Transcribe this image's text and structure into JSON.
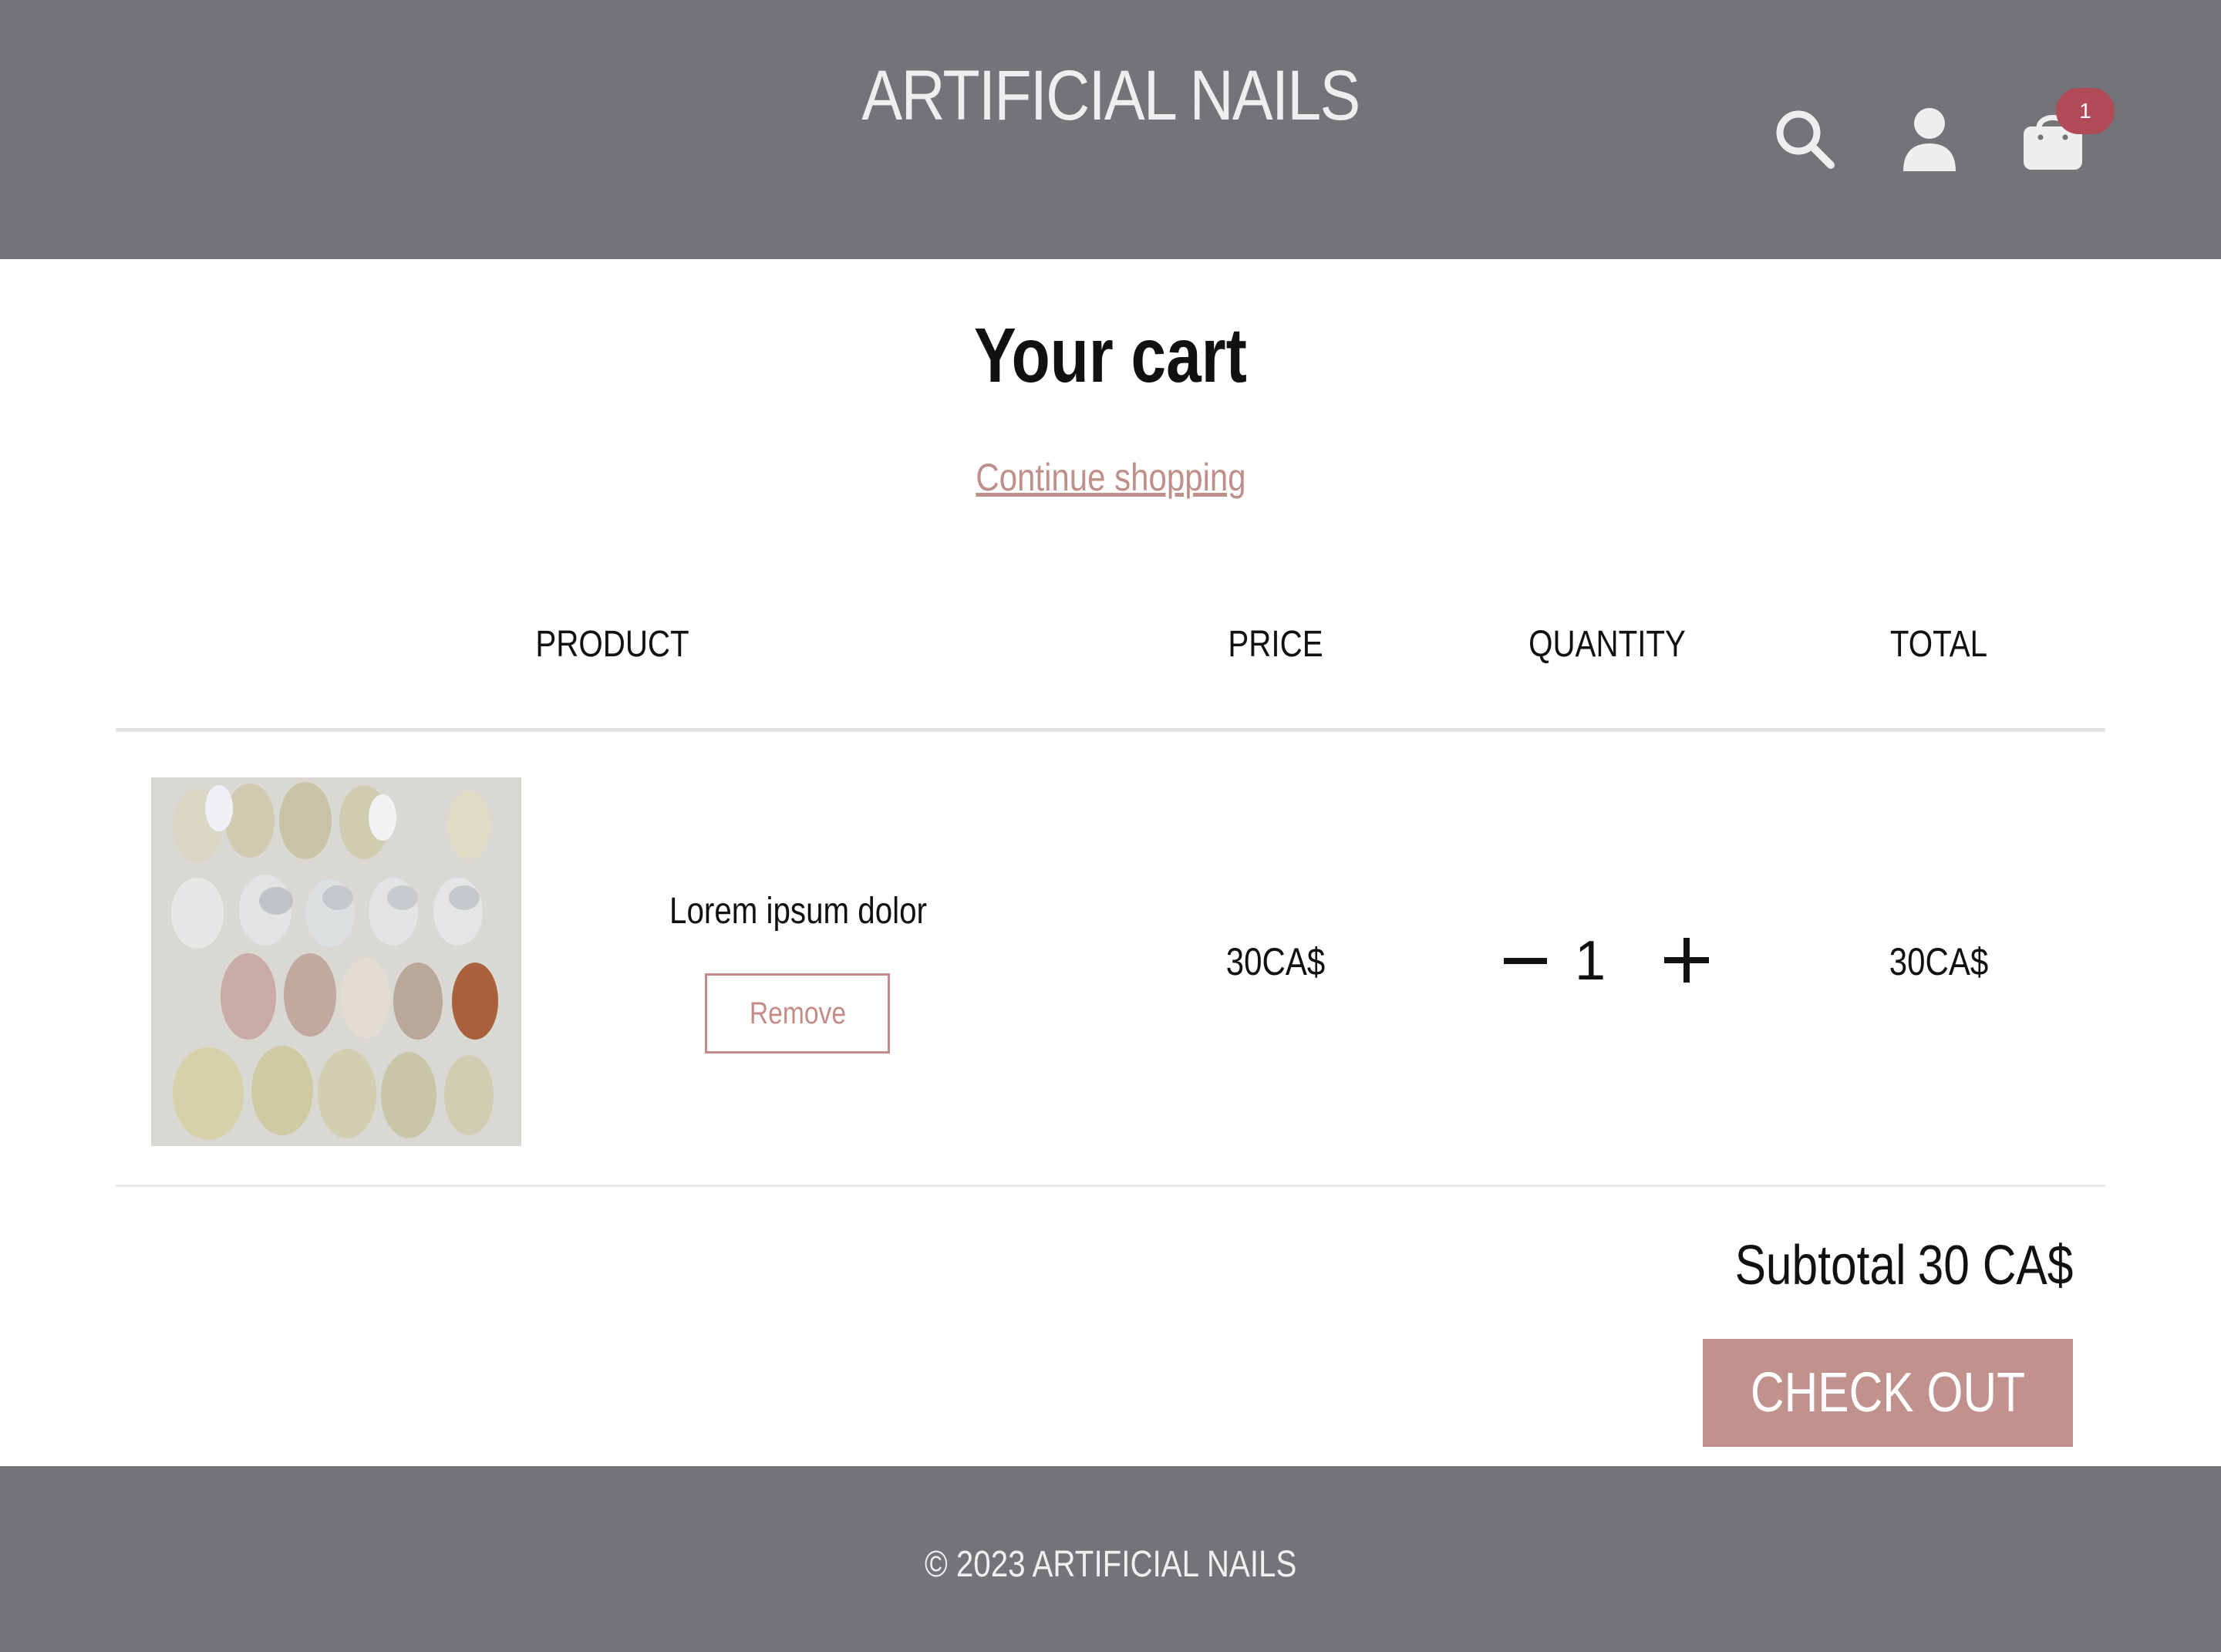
{
  "header": {
    "brand": "ARTIFICIAL NAILS",
    "icons": [
      "search-icon",
      "account-icon",
      "cart-icon"
    ],
    "cart_count": "1"
  },
  "cart": {
    "title": "Your cart",
    "continue_link": "Continue shopping",
    "columns": {
      "product": "PRODUCT",
      "price": "PRICE",
      "quantity": "QUANTITY",
      "total": "TOTAL"
    },
    "items": [
      {
        "name": "Lorem ipsum dolor",
        "remove_label": "Remove",
        "price": "30CA$",
        "quantity": "1",
        "total": "30CA$"
      }
    ],
    "subtotal_label": "Subtotal",
    "subtotal_value": "30 CA$",
    "checkout_label": "CHECK OUT"
  },
  "footer": {
    "copyright": "© 2023 ARTIFICIAL NAILS"
  },
  "colors": {
    "header_bg": "#747378",
    "accent": "#c0918d",
    "badge": "#b34a58"
  }
}
